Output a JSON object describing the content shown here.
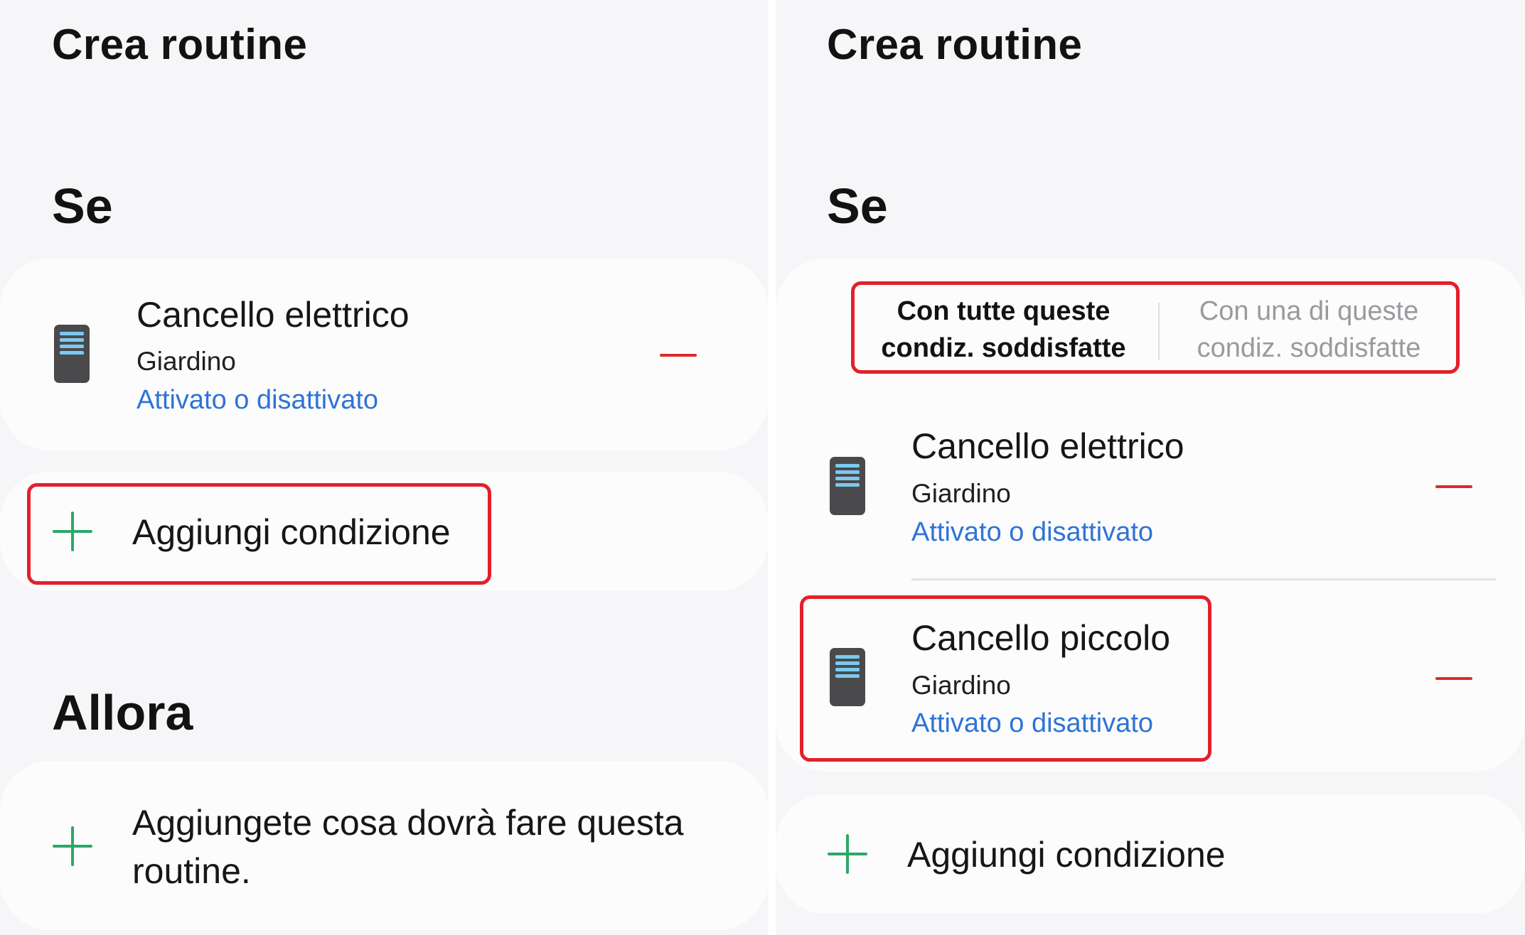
{
  "left": {
    "title": "Crea routine",
    "if_section": "Se",
    "condition": {
      "icon": "gate-device-icon",
      "name": "Cancello elettrico",
      "room": "Giardino",
      "state": "Attivato o disattivato"
    },
    "add_condition_label": "Aggiungi condizione",
    "then_section": "Allora",
    "add_action_line1": "Aggiungete cosa dovrà fare questa",
    "add_action_line2": "routine."
  },
  "right": {
    "title": "Crea routine",
    "if_section": "Se",
    "segment": {
      "all_line1": "Con tutte queste",
      "all_line2": "condiz. soddisfatte",
      "any_line1": "Con una di queste",
      "any_line2": "condiz. soddisfatte"
    },
    "conditions": [
      {
        "icon": "gate-device-icon",
        "name": "Cancello elettrico",
        "room": "Giardino",
        "state": "Attivato o disattivato"
      },
      {
        "icon": "gate-device-icon",
        "name": "Cancello piccolo",
        "room": "Giardino",
        "state": "Attivato o disattivato"
      }
    ],
    "add_condition_label": "Aggiungi condizione"
  },
  "colors": {
    "highlight": "#e3202b",
    "link": "#2f73d6",
    "plus": "#2ba866",
    "minus": "#e0282a",
    "device": "#4a4a4c",
    "device_stripes": "#7cc9f2"
  }
}
